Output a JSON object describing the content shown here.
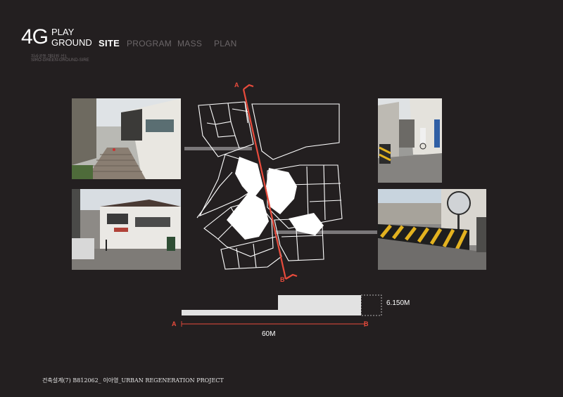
{
  "header": {
    "logo_number": "4G",
    "logo_line1": "PLAY",
    "logo_line2": "GROUND",
    "subtitle1": "자사공동 해터원 선1",
    "subtitle2": "SIRO-GREEN-GROUND-SIRE",
    "nav": [
      {
        "label": "SITE",
        "active": true
      },
      {
        "label": "PROGRAM",
        "active": false
      },
      {
        "label": "MASS",
        "active": false
      },
      {
        "label": "PLAN",
        "active": false
      }
    ]
  },
  "map": {
    "section_label_a": "A",
    "section_label_b": "B"
  },
  "section": {
    "height_label": "6.150M",
    "length_label": "60M",
    "point_a": "A",
    "point_b": "B"
  },
  "photos": [
    {
      "name": "photo-stairs-left-top",
      "desc_icon": "photo"
    },
    {
      "name": "photo-street-left-bottom",
      "desc_icon": "photo"
    },
    {
      "name": "photo-alley-right-top",
      "desc_icon": "photo"
    },
    {
      "name": "photo-barrier-right-bottom",
      "desc_icon": "photo"
    }
  ],
  "colors": {
    "background": "#231f20",
    "accent_red": "#e84b3c",
    "line_white": "#ffffff",
    "connector_gray": "#7a7779"
  },
  "footer": {
    "text": "건축설계(7) B812062_ 이아영_URBAN REGENERATION PROJECT"
  }
}
